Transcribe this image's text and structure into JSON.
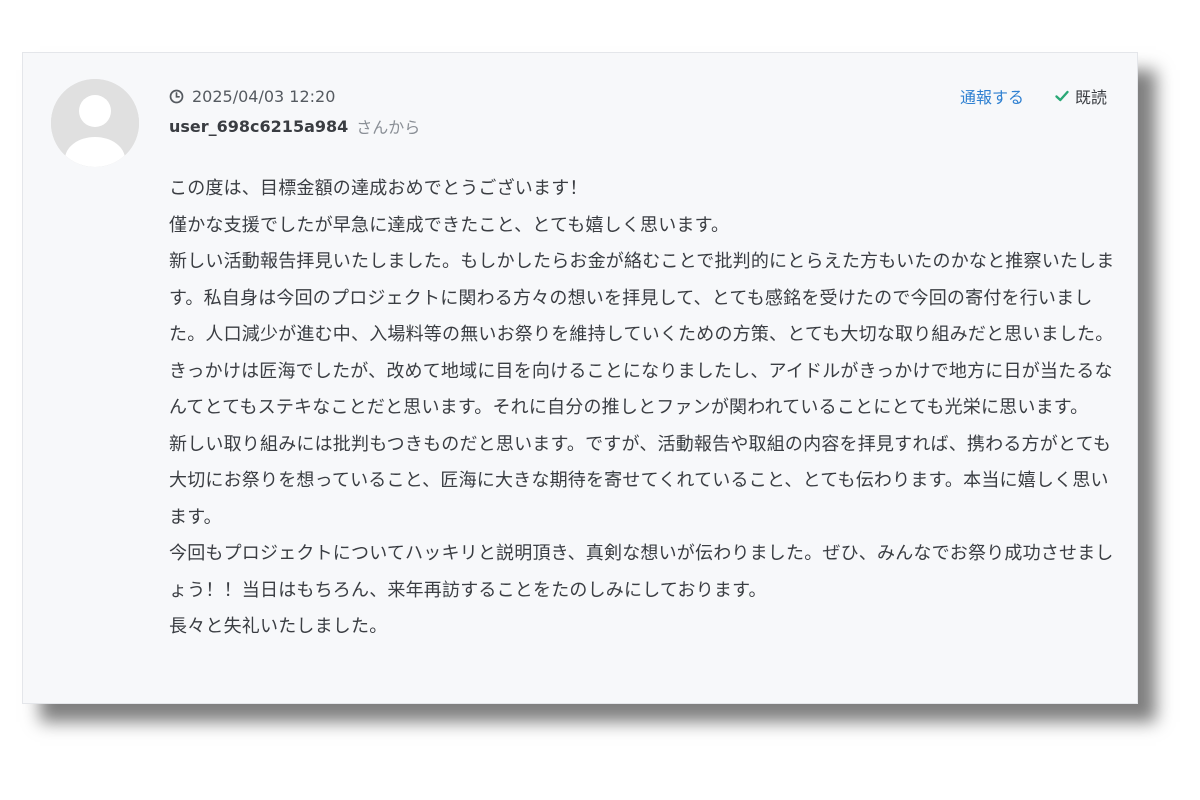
{
  "comment": {
    "timestamp": "2025/04/03 12:20",
    "username": "user_698c6215a984",
    "from_suffix": "さんから",
    "report_label": "通報する",
    "read_label": "既読",
    "paragraphs": [
      "この度は、目標金額の達成おめでとうございます！",
      "僅かな支援でしたが早急に達成できたこと、とても嬉しく思います。",
      "新しい活動報告拝見いたしました。もしかしたらお金が絡むことで批判的にとらえた方もいたのかなと推察いたします。私自身は今回のプロジェクトに関わる方々の想いを拝見して、とても感銘を受けたので今回の寄付を行いました。人口減少が進む中、入場料等の無いお祭りを維持していくための方策、とても大切な取り組みだと思いました。きっかけは匠海でしたが、改めて地域に目を向けることになりましたし、アイドルがきっかけで地方に日が当たるなんてとてもステキなことだと思います。それに自分の推しとファンが関われていることにとても光栄に思います。",
      "新しい取り組みには批判もつきものだと思います。ですが、活動報告や取組の内容を拝見すれば、携わる方がとても大切にお祭りを想っていること、匠海に大きな期待を寄せてくれていること、とても伝わります。本当に嬉しく思います。",
      "今回もプロジェクトについてハッキリと説明頂き、真剣な想いが伝わりました。ぜひ、みんなでお祭り成功させましょう！！当日はもちろん、来年再訪することをたのしみにしております。",
      "長々と失礼いたしました。"
    ]
  },
  "colors": {
    "card_background": "#f7f8fa",
    "link": "#2f80d1",
    "check": "#2aa876",
    "text": "#3a3d42",
    "muted": "#8a8f96"
  },
  "icons": {
    "avatar": "default-user-avatar",
    "time": "clock-icon",
    "read": "check-icon"
  }
}
